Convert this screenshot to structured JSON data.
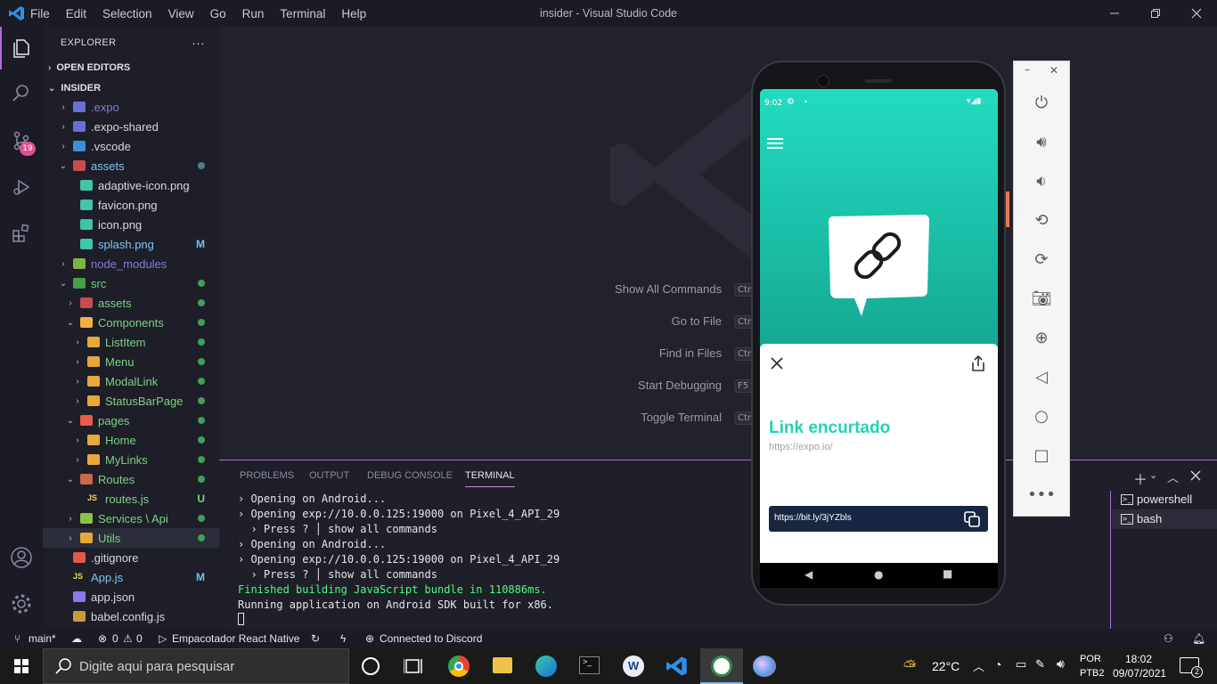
{
  "window": {
    "title": "insider - Visual Studio Code",
    "menu": [
      "File",
      "Edit",
      "Selection",
      "View",
      "Go",
      "Run",
      "Terminal",
      "Help"
    ]
  },
  "activity": {
    "scm_badge": "19"
  },
  "sidebar": {
    "header": "EXPLORER",
    "more": "···",
    "open_editors": "OPEN EDITORS",
    "project": "INSIDER",
    "rows": [
      {
        "label": ".expo",
        "color": "#7d80d0",
        "badge": ""
      },
      {
        "label": ".expo-shared",
        "color": "#d8d8e0",
        "badge": ""
      },
      {
        "label": ".vscode",
        "color": "#d8d8e0",
        "badge": ""
      },
      {
        "label": "assets",
        "color": "#7dc7f0",
        "badge": ""
      },
      {
        "label": "adaptive-icon.png",
        "color": "#d8d8e0",
        "badge": ""
      },
      {
        "label": "favicon.png",
        "color": "#d8d8e0",
        "badge": ""
      },
      {
        "label": "icon.png",
        "color": "#d8d8e0",
        "badge": ""
      },
      {
        "label": "splash.png",
        "color": "#7dc7f0",
        "badge": "M"
      },
      {
        "label": "node_modules",
        "color": "#7d80d0",
        "badge": ""
      },
      {
        "label": "src",
        "color": "#7fd088",
        "badge": ""
      },
      {
        "label": "assets",
        "color": "#7fd088",
        "badge": ""
      },
      {
        "label": "Components",
        "color": "#7fd088",
        "badge": ""
      },
      {
        "label": "ListItem",
        "color": "#7fd088",
        "badge": ""
      },
      {
        "label": "Menu",
        "color": "#7fd088",
        "badge": ""
      },
      {
        "label": "ModalLink",
        "color": "#7fd088",
        "badge": ""
      },
      {
        "label": "StatusBarPage",
        "color": "#7fd088",
        "badge": ""
      },
      {
        "label": "pages",
        "color": "#7fd088",
        "badge": ""
      },
      {
        "label": "Home",
        "color": "#7fd088",
        "badge": ""
      },
      {
        "label": "MyLinks",
        "color": "#7fd088",
        "badge": ""
      },
      {
        "label": "Routes",
        "color": "#7fd088",
        "badge": ""
      },
      {
        "label": "routes.js",
        "color": "#7fd088",
        "badge": "U"
      },
      {
        "label": "Services \\ Api",
        "color": "#7fd088",
        "badge": ""
      },
      {
        "label": "Utils",
        "color": "#7fd088",
        "badge": ""
      },
      {
        "label": ".gitignore",
        "color": "#d8d8e0",
        "badge": ""
      },
      {
        "label": "App.js",
        "color": "#7dc7f0",
        "badge": "M"
      },
      {
        "label": "app.json",
        "color": "#d8d8e0",
        "badge": ""
      },
      {
        "label": "babel.config.js",
        "color": "#d8d8e0",
        "badge": ""
      }
    ]
  },
  "editor": {
    "commands": [
      {
        "label": "Show All Commands",
        "key": "Ctr"
      },
      {
        "label": "Go to File",
        "key": "Ctr"
      },
      {
        "label": "Find in Files",
        "key": "Ctr"
      },
      {
        "label": "Start Debugging",
        "key": "F5"
      },
      {
        "label": "Toggle Terminal",
        "key": "Ctr"
      }
    ]
  },
  "panel": {
    "tabs": [
      "PROBLEMS",
      "OUTPUT",
      "DEBUG CONSOLE",
      "TERMINAL"
    ],
    "active_tab": "TERMINAL",
    "terminal_lines": [
      {
        "text": "› Opening on Android...",
        "color": "#e6e6e6"
      },
      {
        "text": "› Opening exp://10.0.0.125:19000 on Pixel_4_API_29",
        "color": "#e6e6e6"
      },
      {
        "text": "  › Press ? │ show all commands",
        "color": "#e6e6e6"
      },
      {
        "text": "› Opening on Android...",
        "color": "#e6e6e6"
      },
      {
        "text": "› Opening exp://10.0.0.125:19000 on Pixel_4_API_29",
        "color": "#e6e6e6"
      },
      {
        "text": "  › Press ? │ show all commands",
        "color": "#e6e6e6"
      },
      {
        "text": "Finished building JavaScript bundle in 110886ms.",
        "color": "#50fa7b"
      },
      {
        "text": "Running application on Android SDK built for x86.",
        "color": "#e6e6e6"
      }
    ],
    "terminals": [
      "powershell",
      "bash"
    ]
  },
  "statusbar": {
    "branch": "main*",
    "errors": "0",
    "warnings": "0",
    "task": "Empacotador React Native",
    "discord": "Connected to Discord"
  },
  "phone": {
    "time": "9:02",
    "modal_title": "Link encurtado",
    "modal_subtitle": "https://expo.io/",
    "short_link": "https://bit.ly/3jYZbls",
    "accent": "#22d3b6"
  },
  "taskbar": {
    "search_placeholder": "Digite aqui para pesquisar",
    "weather": "22°C",
    "lang1": "POR",
    "lang2": "PTB2",
    "time": "18:02",
    "date": "09/07/2021",
    "notifications": "2"
  }
}
